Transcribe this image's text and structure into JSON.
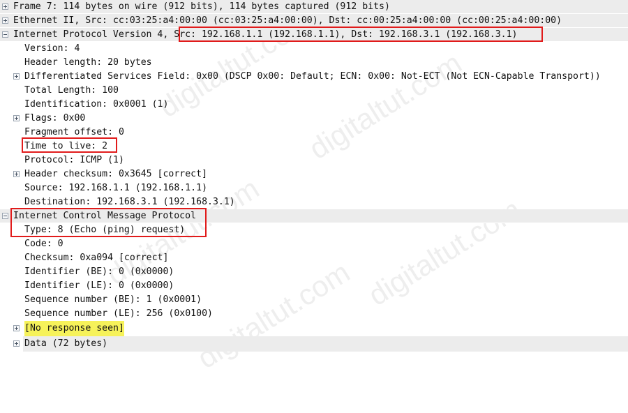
{
  "tree": {
    "frame": "Frame 7: 114 bytes on wire (912 bits), 114 bytes captured (912 bits)",
    "ethernet": "Ethernet II, Src: cc:03:25:a4:00:00 (cc:03:25:a4:00:00), Dst: cc:00:25:a4:00:00 (cc:00:25:a4:00:00)",
    "ip_prefix": "Internet Protocol Version 4, ",
    "ip_addrs": "Src: 192.168.1.1 (192.168.1.1), Dst: 192.168.3.1 (192.168.3.1)",
    "ip_fields": {
      "version": "Version: 4",
      "header_length": "Header length: 20 bytes",
      "dsfield": "Differentiated Services Field: 0x00 (DSCP 0x00: Default; ECN: 0x00: Not-ECT (Not ECN-Capable Transport))",
      "total_length": "Total Length: 100",
      "identification": "Identification: 0x0001 (1)",
      "flags": "Flags: 0x00",
      "fragment_offset": "Fragment offset: 0",
      "ttl": "Time to live: 2",
      "protocol": "Protocol: ICMP (1)",
      "checksum": "Header checksum: 0x3645 [correct]",
      "source": "Source: 192.168.1.1 (192.168.1.1)",
      "destination": "Destination: 192.168.3.1 (192.168.3.1)"
    },
    "icmp": "Internet Control Message Protocol",
    "icmp_fields": {
      "type": "Type: 8 (Echo (ping) request)",
      "code": "Code: 0",
      "checksum": "Checksum: 0xa094 [correct]",
      "id_be": "Identifier (BE): 0 (0x0000)",
      "id_le": "Identifier (LE): 0 (0x0000)",
      "seq_be": "Sequence number (BE): 1 (0x0001)",
      "seq_le": "Sequence number (LE): 256 (0x0100)",
      "no_response": "[No response seen]",
      "data": "Data (72 bytes)"
    }
  },
  "watermark": "digitaltut.com",
  "colors": {
    "highlight_box": "#e11b1b",
    "no_response_highlight": "#f6f25a",
    "top_row_bg": "#ececec"
  }
}
